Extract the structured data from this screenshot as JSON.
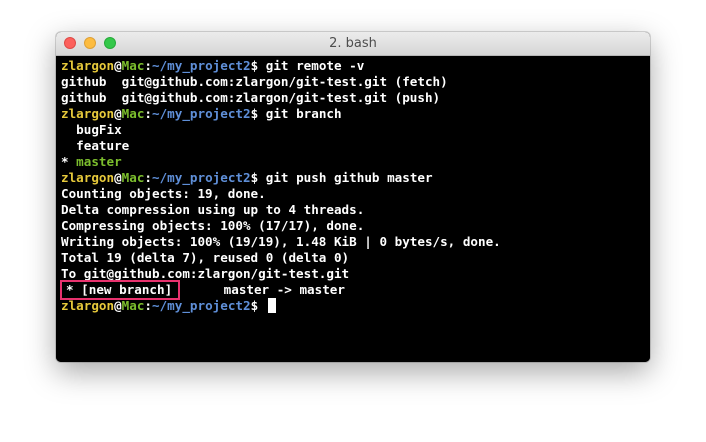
{
  "window": {
    "title": "2. bash",
    "colors": {
      "close": "#fc605c",
      "minimize": "#fdbc40",
      "zoom": "#34c84a",
      "highlight": "#e8326e"
    }
  },
  "prompt": {
    "user": "zlargon",
    "at": "@",
    "host": "Mac",
    "sep": ":",
    "path": "~/my_project2",
    "dollar": "$ "
  },
  "lines": [
    {
      "kind": "prompt",
      "cmd": "git remote -v"
    },
    {
      "kind": "text",
      "text": "github  git@github.com:zlargon/git-test.git (fetch)"
    },
    {
      "kind": "text",
      "text": "github  git@github.com:zlargon/git-test.git (push)"
    },
    {
      "kind": "prompt",
      "cmd": "git branch"
    },
    {
      "kind": "text",
      "text": "  bugFix"
    },
    {
      "kind": "text",
      "text": "  feature"
    },
    {
      "kind": "current",
      "star": "* ",
      "text": "master"
    },
    {
      "kind": "prompt",
      "cmd": "git push github master"
    },
    {
      "kind": "text",
      "text": "Counting objects: 19, done."
    },
    {
      "kind": "text",
      "text": "Delta compression using up to 4 threads."
    },
    {
      "kind": "text",
      "text": "Compressing objects: 100% (17/17), done."
    },
    {
      "kind": "text",
      "text": "Writing objects: 100% (19/19), 1.48 KiB | 0 bytes/s, done."
    },
    {
      "kind": "text",
      "text": "Total 19 (delta 7), reused 0 (delta 0)"
    },
    {
      "kind": "text",
      "text": "To git@github.com:zlargon/git-test.git"
    },
    {
      "kind": "newbranch",
      "boxed": "* [new branch]",
      "rest": "      master -> master"
    },
    {
      "kind": "prompt",
      "cmd": "",
      "cursor": true
    }
  ]
}
